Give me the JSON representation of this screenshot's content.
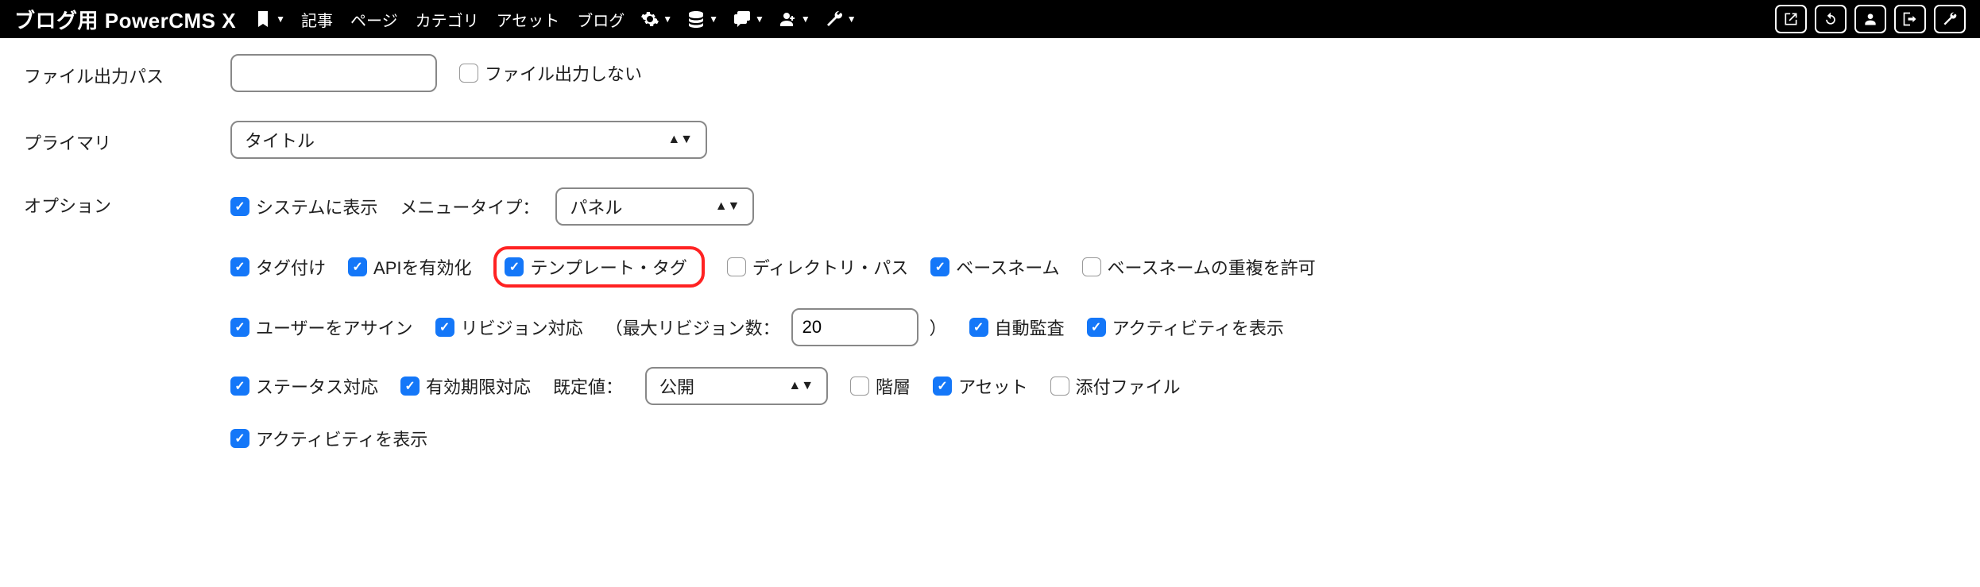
{
  "navbar": {
    "brand": "ブログ用 PowerCMS X",
    "items": [
      "記事",
      "ページ",
      "カテゴリ",
      "アセット",
      "ブログ"
    ]
  },
  "form": {
    "file_output_path": {
      "label": "ファイル出力パス",
      "value": "",
      "no_output_label": "ファイル出力しない"
    },
    "primary": {
      "label": "プライマリ",
      "selected": "タイトル"
    },
    "options": {
      "label": "オプション",
      "show_in_system": "システムに表示",
      "menu_type_label": "メニュータイプ：",
      "menu_type_value": "パネル",
      "tagging": "タグ付け",
      "enable_api": "APIを有効化",
      "template_tag": "テンプレート・タグ",
      "directory_path": "ディレクトリ・パス",
      "basename": "ベースネーム",
      "allow_basename_dup": "ベースネームの重複を許可",
      "assign_user": "ユーザーをアサイン",
      "revision": "リビジョン対応",
      "max_revisions_label": "（最大リビジョン数：",
      "max_revisions_value": "20",
      "max_revisions_close": "）",
      "auto_audit": "自動監査",
      "show_activity": "アクティビティを表示",
      "status": "ステータス対応",
      "expiry": "有効期限対応",
      "default_label": "既定値：",
      "default_value": "公開",
      "hierarchy": "階層",
      "asset": "アセット",
      "attachment": "添付ファイル",
      "show_activity2": "アクティビティを表示"
    }
  }
}
